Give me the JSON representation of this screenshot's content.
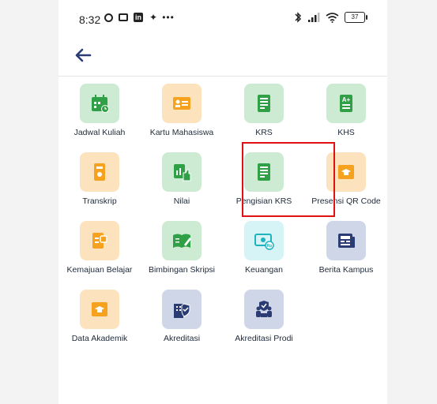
{
  "status_bar": {
    "time": "8:32",
    "battery": "37"
  },
  "colors": {
    "green_tile": "#cdebd2",
    "green_icon": "#2fa046",
    "orange_tile": "#fde3bd",
    "orange_icon": "#f6a21f",
    "cyan_tile": "#d6f3f6",
    "cyan_icon": "#1fb3bf",
    "navy_tile": "#cfd6e8",
    "navy_icon": "#2b3c75",
    "highlight": "#e11111"
  },
  "menu": [
    {
      "label": "Jadwal Kuliah",
      "icon": "calendar-icon",
      "color": "green"
    },
    {
      "label": "Kartu Mahasiswa",
      "icon": "id-card-icon",
      "color": "orange"
    },
    {
      "label": "KRS",
      "icon": "document-icon",
      "color": "green"
    },
    {
      "label": "KHS",
      "icon": "grade-document-icon",
      "color": "green"
    },
    {
      "label": "Transkrip",
      "icon": "transcript-icon",
      "color": "orange"
    },
    {
      "label": "Nilai",
      "icon": "score-thumb-icon",
      "color": "green"
    },
    {
      "label": "Pengisian KRS",
      "icon": "document-icon",
      "color": "green"
    },
    {
      "label": "Presensi QR Code",
      "icon": "graduation-folder-icon",
      "color": "orange"
    },
    {
      "label": "Kemajuan Belajar",
      "icon": "progress-icon",
      "color": "orange"
    },
    {
      "label": "Bimbingan Skripsi",
      "icon": "book-pen-icon",
      "color": "green"
    },
    {
      "label": "Keuangan",
      "icon": "money-icon",
      "color": "cyan"
    },
    {
      "label": "Berita Kampus",
      "icon": "newspaper-icon",
      "color": "navy"
    },
    {
      "label": "Data Akademik",
      "icon": "graduation-folder-icon",
      "color": "orange"
    },
    {
      "label": "Akreditasi",
      "icon": "building-shield-icon",
      "color": "navy"
    },
    {
      "label": "Akreditasi Prodi",
      "icon": "people-shield-icon",
      "color": "navy"
    }
  ]
}
